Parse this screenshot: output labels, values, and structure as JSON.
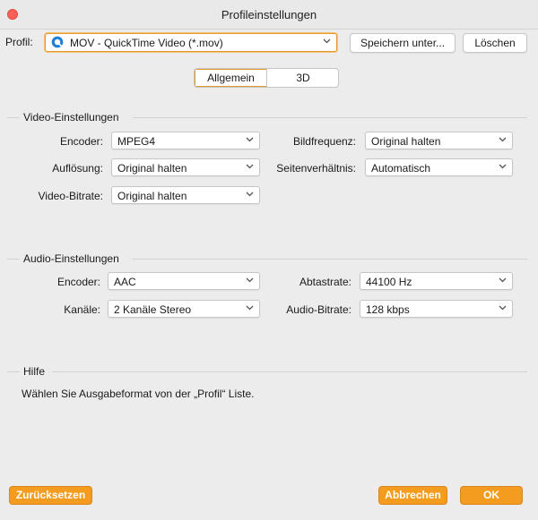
{
  "window": {
    "title": "Profileinstellungen"
  },
  "toolbar": {
    "profile_label": "Profil:",
    "profile_value": "MOV - QuickTime Video (*.mov)",
    "save_as_label": "Speichern unter...",
    "delete_label": "Löschen"
  },
  "tabs": [
    {
      "label": "Allgemein",
      "active": true
    },
    {
      "label": "3D",
      "active": false
    }
  ],
  "video": {
    "title": "Video-Einstellungen",
    "encoder_label": "Encoder:",
    "encoder_value": "MPEG4",
    "framerate_label": "Bildfrequenz:",
    "framerate_value": "Original halten",
    "resolution_label": "Auflösung:",
    "resolution_value": "Original halten",
    "aspect_label": "Seitenverhältnis:",
    "aspect_value": "Automatisch",
    "bitrate_label": "Video-Bitrate:",
    "bitrate_value": "Original halten"
  },
  "audio": {
    "title": "Audio-Einstellungen",
    "encoder_label": "Encoder:",
    "encoder_value": "AAC",
    "samplerate_label": "Abtastrate:",
    "samplerate_value": "44100 Hz",
    "channels_label": "Kanäle:",
    "channels_value": "2 Kanäle Stereo",
    "bitrate_label": "Audio-Bitrate:",
    "bitrate_value": "128 kbps"
  },
  "help": {
    "title": "Hilfe",
    "text": "Wählen Sie Ausgabeformat von der „Profil“ Liste."
  },
  "footer": {
    "reset_label": "Zurücksetzen",
    "cancel_label": "Abbrechen",
    "ok_label": "OK"
  },
  "colors": {
    "accent": "#f39c1f",
    "close_button": "#fc5f57",
    "quicktime_icon": "#1f7fd8"
  }
}
